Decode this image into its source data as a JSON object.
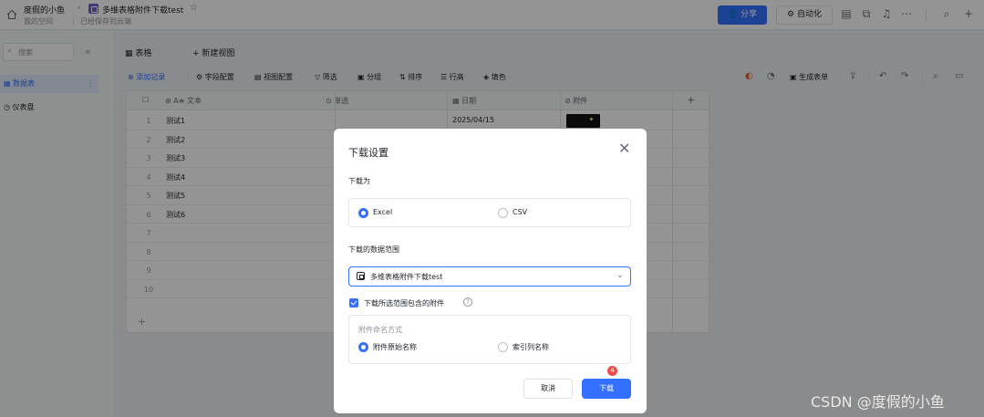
{
  "breadcrumb": {
    "space": "度假的小鱼",
    "doc_title": "多维表格附件下载test",
    "location": "我的空间",
    "save_status": "已经保存到云端"
  },
  "header": {
    "share_label": "分享",
    "automation_label": "自动化"
  },
  "sidebar": {
    "search_placeholder": "搜索",
    "items": [
      {
        "label": "数据表"
      },
      {
        "label": "仪表盘"
      }
    ]
  },
  "view_tabs": {
    "table_label": "表格",
    "new_view_label": "新建视图"
  },
  "toolbar": {
    "add_record": "添加记录",
    "field_config": "字段配置",
    "view_config": "视图配置",
    "filter": "筛选",
    "group": "分组",
    "sort": "排序",
    "row_height": "行高",
    "fill_color": "填色",
    "generate_form": "生成表单"
  },
  "grid": {
    "columns": [
      "文本",
      "单选",
      "日期",
      "附件"
    ],
    "rows": [
      {
        "num": "1",
        "text": "测试1",
        "date": "2025/04/15",
        "has_attachment": true
      },
      {
        "num": "2",
        "text": "测试2"
      },
      {
        "num": "3",
        "text": "测试3"
      },
      {
        "num": "4",
        "text": "测试4"
      },
      {
        "num": "5",
        "text": "测试5"
      },
      {
        "num": "6",
        "text": "测试6"
      },
      {
        "num": "7",
        "text": ""
      },
      {
        "num": "8",
        "text": ""
      },
      {
        "num": "9",
        "text": ""
      },
      {
        "num": "10",
        "text": ""
      }
    ]
  },
  "modal": {
    "title": "下载设置",
    "download_as_label": "下载为",
    "format_options": [
      {
        "label": "Excel",
        "selected": true
      },
      {
        "label": "CSV",
        "selected": false
      }
    ],
    "range_label": "下载的数据范围",
    "range_value": "多维表格附件下载test",
    "include_attachments_label": "下载所选范围包含的附件",
    "include_attachments_checked": true,
    "naming_title": "附件命名方式",
    "naming_options": [
      {
        "label": "附件原始名称",
        "selected": true
      },
      {
        "label": "索引列名称",
        "selected": false
      }
    ],
    "cancel_label": "取消",
    "download_label": "下载",
    "step_badge": "4"
  },
  "watermark": "CSDN @度假的小鱼",
  "colors": {
    "accent": "#3370ff",
    "badge": "#f54a45",
    "doc_icon": "#7b61d9"
  }
}
